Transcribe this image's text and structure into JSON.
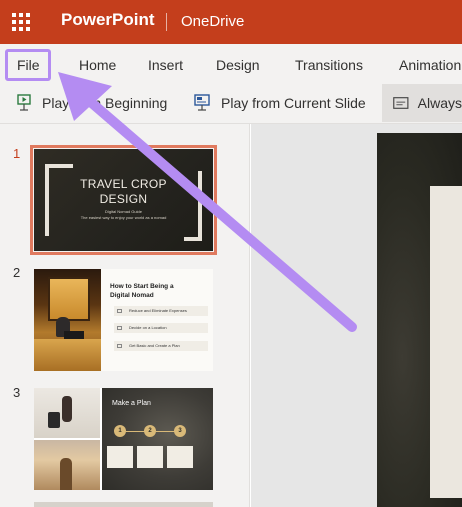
{
  "titlebar": {
    "app_name": "PowerPoint",
    "location": "OneDrive",
    "background_color": "#c43e1c"
  },
  "ribbon": {
    "tabs": [
      {
        "label": "File",
        "highlighted": true
      },
      {
        "label": "Home"
      },
      {
        "label": "Insert"
      },
      {
        "label": "Design"
      },
      {
        "label": "Transitions"
      },
      {
        "label": "Animation"
      }
    ]
  },
  "commands": {
    "play_from_beginning": "Play from Beginning",
    "play_from_current": "Play from Current Slide",
    "always": "Always"
  },
  "slides": [
    {
      "number": "1",
      "title_line1": "TRAVEL CROP",
      "title_line2": "DESIGN",
      "subtitle_line1": "Digital Nomad Guide",
      "subtitle_line2": "The easiest way to enjoy your world as a nomad"
    },
    {
      "number": "2",
      "heading_line1": "How to Start Being a",
      "heading_line2": "Digital Nomad",
      "items": [
        "Reduce and Eliminate Expenses",
        "Decide on a Location",
        "Get Basic and Create a Plan"
      ]
    },
    {
      "number": "3",
      "heading": "Make a Plan",
      "steps": [
        "1",
        "2",
        "3"
      ]
    }
  ],
  "annotation": {
    "color": "#b48cf2",
    "target": "File"
  }
}
